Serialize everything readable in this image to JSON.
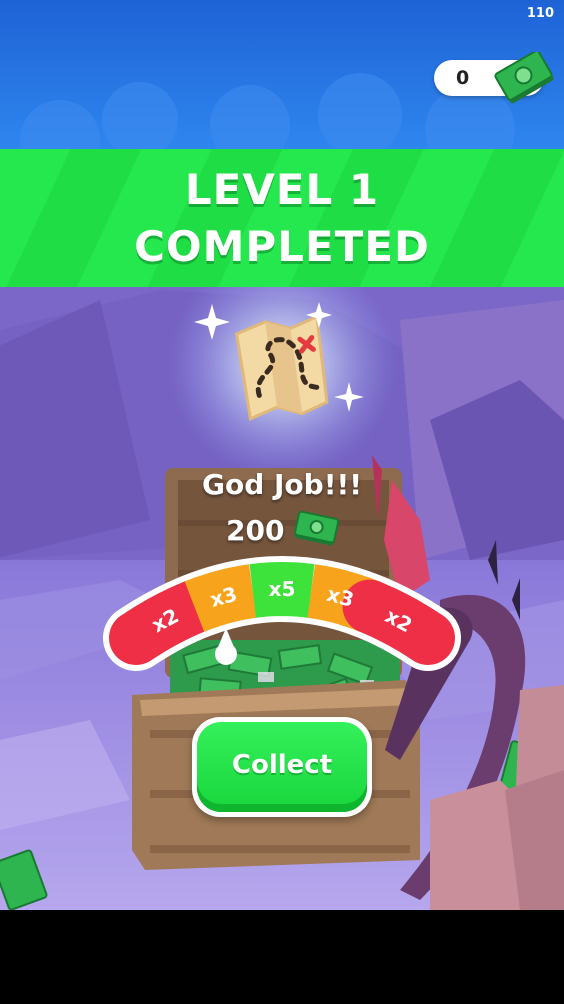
{
  "status": {
    "fps": "110"
  },
  "currency": {
    "count": "0",
    "icon": "cash-icon"
  },
  "banner": {
    "line1": "LEVEL 1",
    "line2": "COMPLETED"
  },
  "reward": {
    "message": "God Job!!!",
    "amount": "200",
    "icon": "cash-icon",
    "item_icon": "treasure-map-icon"
  },
  "multiplier": {
    "segments": [
      {
        "label": "x2",
        "color": "#ee2f45"
      },
      {
        "label": "x3",
        "color": "#f7a41c"
      },
      {
        "label": "x5",
        "color": "#3de23a"
      },
      {
        "label": "x3",
        "color": "#f7a41c"
      },
      {
        "label": "x2",
        "color": "#ee2f45"
      }
    ],
    "needle_segment": "x3"
  },
  "collect": {
    "label": "Collect"
  },
  "colors": {
    "banner_green": "#24e84d",
    "sky_blue": "#1f6fd8",
    "button_green": "#22e046"
  }
}
